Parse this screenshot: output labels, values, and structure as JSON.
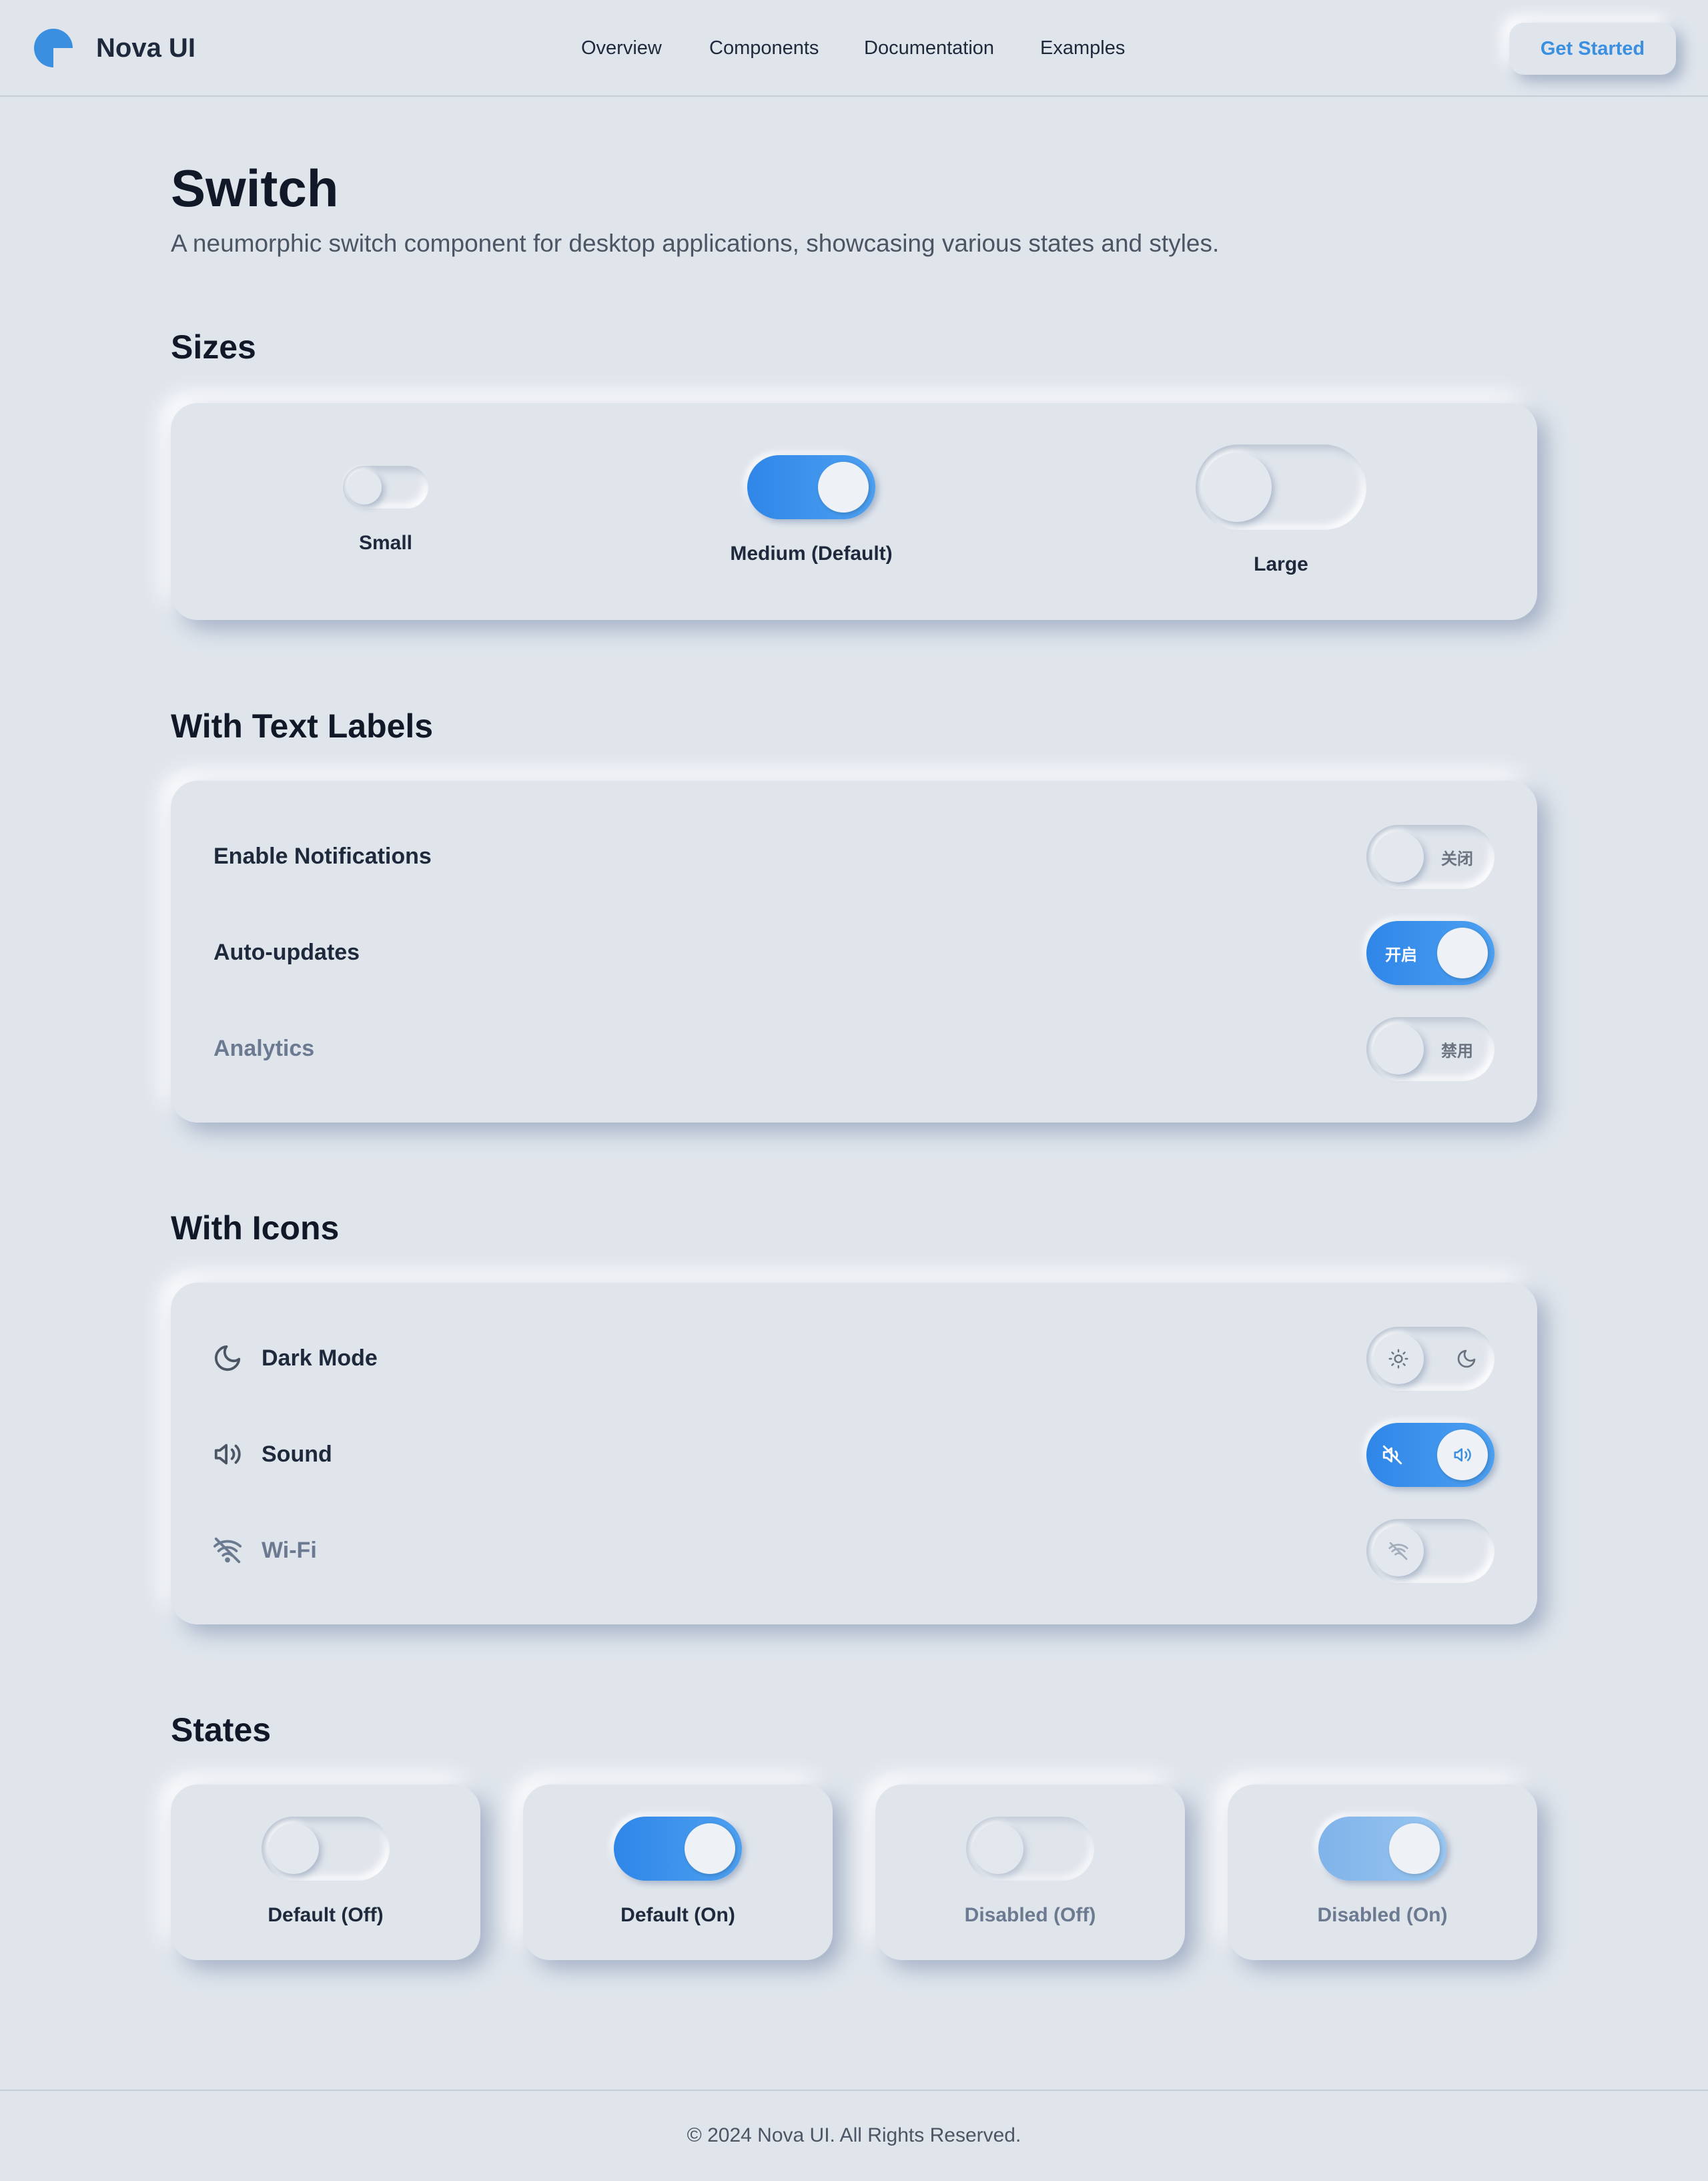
{
  "header": {
    "brand": "Nova UI",
    "nav": [
      "Overview",
      "Components",
      "Documentation",
      "Examples"
    ],
    "cta": "Get Started",
    "accent": "#3b8fe0"
  },
  "page": {
    "title": "Switch",
    "subtitle": "A neumorphic switch component for desktop applications, showcasing various states and styles."
  },
  "sizes": {
    "title": "Sizes",
    "items": [
      {
        "label": "Small",
        "checked": false
      },
      {
        "label": "Medium (Default)",
        "checked": true
      },
      {
        "label": "Large",
        "checked": false
      }
    ]
  },
  "text_labels": {
    "title": "With Text Labels",
    "rows": [
      {
        "label": "Enable Notifications",
        "switch_text": "关闭",
        "checked": false,
        "disabled": false
      },
      {
        "label": "Auto-updates",
        "switch_text": "开启",
        "checked": true,
        "disabled": false
      },
      {
        "label": "Analytics",
        "switch_text": "禁用",
        "checked": false,
        "disabled": true
      }
    ]
  },
  "icons": {
    "title": "With Icons",
    "rows": [
      {
        "label": "Dark Mode",
        "icon": "moon-icon",
        "checked": false,
        "disabled": false
      },
      {
        "label": "Sound",
        "icon": "speaker-icon",
        "checked": true,
        "disabled": false
      },
      {
        "label": "Wi-Fi",
        "icon": "wifi-off-icon",
        "checked": false,
        "disabled": true
      }
    ]
  },
  "states": {
    "title": "States",
    "items": [
      {
        "label": "Default (Off)",
        "checked": false,
        "disabled": false
      },
      {
        "label": "Default (On)",
        "checked": true,
        "disabled": false
      },
      {
        "label": "Disabled (Off)",
        "checked": false,
        "disabled": true
      },
      {
        "label": "Disabled (On)",
        "checked": true,
        "disabled": true
      }
    ]
  },
  "footer": {
    "text": "© 2024 Nova UI. All Rights Reserved."
  },
  "colors": {
    "background": "#e0e5ec",
    "switch_on": "#2f86e8",
    "text": "#111827",
    "muted": "#6b7a90"
  }
}
